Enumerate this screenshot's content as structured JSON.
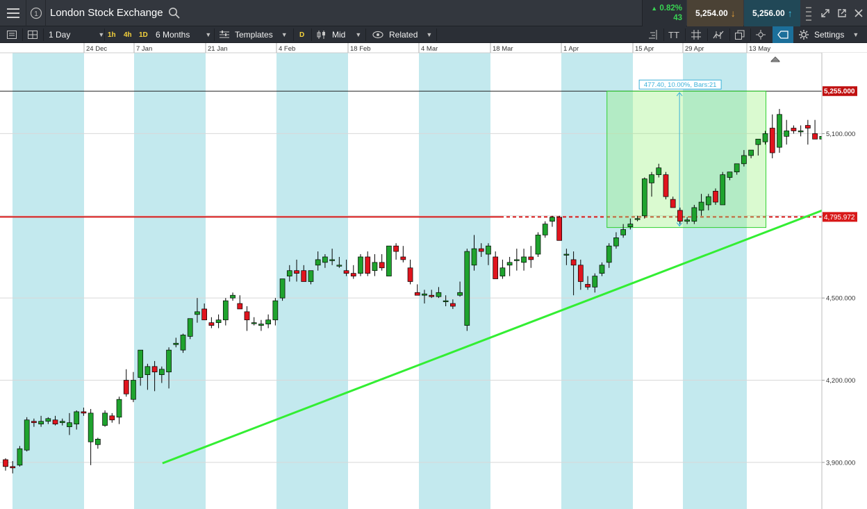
{
  "header": {
    "title": "London Stock Exchange",
    "change_pct": "0.82%",
    "change_pts": "43",
    "sell_price": "5,254.00",
    "buy_price": "5,256.00",
    "info_label": "1"
  },
  "toolbar": {
    "interval": "1 Day",
    "tf_1h": "1h",
    "tf_4h": "4h",
    "tf_1d": "1D",
    "period": "6 Months",
    "templates": "Templates",
    "d_badge": "D",
    "price_type": "Mid",
    "related": "Related",
    "font_label": "TT",
    "settings": "Settings"
  },
  "colors": {
    "up": "#1fa32e",
    "down": "#e0141e",
    "shade": "#c3e9ee",
    "trendline": "#33ee33",
    "hline": "#d81818",
    "measure": "#3ab0d8"
  },
  "chart_data": {
    "type": "candlestick",
    "x_tick_labels": [
      "24 Dec",
      "7 Jan",
      "21 Jan",
      "4 Feb",
      "18 Feb",
      "4 Mar",
      "18 Mar",
      "1 Apr",
      "15 Apr",
      "29 Apr",
      "13 May"
    ],
    "y_tick_labels": [
      "5,100.000",
      "4,800.000",
      "4,500.000",
      "4,200.000",
      "3,900.000"
    ],
    "y_ticks": [
      5100,
      4800,
      4500,
      4200,
      3900
    ],
    "ylim": [
      3730,
      5395
    ],
    "last_price_label": "5,255.000",
    "last_price": 5255,
    "hline_label": "4,795.972",
    "hline_price": 4795.972,
    "measure_label": "477.40, 10.00%, Bars:21",
    "measure_from_price": 4777.6,
    "measure_to_price": 5255,
    "trendline": {
      "from": {
        "bar": 22,
        "price": 3897
      },
      "to_price_right_edge": 4819
    },
    "candles": [
      [
        3910,
        3915,
        3870,
        3885
      ],
      [
        3885,
        3905,
        3860,
        3880
      ],
      [
        3890,
        3960,
        3885,
        3950
      ],
      [
        3945,
        4065,
        3940,
        4055
      ],
      [
        4050,
        4060,
        4030,
        4045
      ],
      [
        4040,
        4070,
        4030,
        4050
      ],
      [
        4050,
        4065,
        4040,
        4060
      ],
      [
        4055,
        4070,
        4035,
        4040
      ],
      [
        4045,
        4060,
        4035,
        4050
      ],
      [
        4030,
        4080,
        4000,
        4045
      ],
      [
        4040,
        4090,
        4020,
        4085
      ],
      [
        4085,
        4100,
        4070,
        4080
      ],
      [
        3975,
        4095,
        3890,
        4080
      ],
      [
        3965,
        3990,
        3950,
        3985
      ],
      [
        4035,
        4090,
        4030,
        4080
      ],
      [
        4070,
        4080,
        4045,
        4055
      ],
      [
        4065,
        4140,
        4040,
        4130
      ],
      [
        4200,
        4240,
        4140,
        4150
      ],
      [
        4130,
        4230,
        4120,
        4200
      ],
      [
        4210,
        4270,
        4180,
        4310
      ],
      [
        4220,
        4260,
        4165,
        4250
      ],
      [
        4250,
        4270,
        4160,
        4230
      ],
      [
        4220,
        4250,
        4190,
        4240
      ],
      [
        4230,
        4320,
        4170,
        4310
      ],
      [
        4330,
        4355,
        4320,
        4335
      ],
      [
        4310,
        4370,
        4300,
        4365
      ],
      [
        4360,
        4420,
        4350,
        4425
      ],
      [
        4440,
        4500,
        4410,
        4450
      ],
      [
        4460,
        4480,
        4425,
        4420
      ],
      [
        4410,
        4430,
        4390,
        4400
      ],
      [
        4410,
        4440,
        4390,
        4420
      ],
      [
        4420,
        4500,
        4400,
        4490
      ],
      [
        4500,
        4520,
        4490,
        4510
      ],
      [
        4480,
        4510,
        4460,
        4460
      ],
      [
        4450,
        4470,
        4380,
        4420
      ],
      [
        4410,
        4430,
        4400,
        4410
      ],
      [
        4400,
        4420,
        4380,
        4405
      ],
      [
        4405,
        4440,
        4390,
        4420
      ],
      [
        4420,
        4500,
        4400,
        4490
      ],
      [
        4500,
        4540,
        4490,
        4570
      ],
      [
        4580,
        4620,
        4560,
        4600
      ],
      [
        4600,
        4640,
        4560,
        4590
      ],
      [
        4600,
        4620,
        4560,
        4560
      ],
      [
        4560,
        4600,
        4550,
        4600
      ],
      [
        4620,
        4670,
        4600,
        4640
      ],
      [
        4630,
        4660,
        4610,
        4650
      ],
      [
        4640,
        4680,
        4620,
        4640
      ],
      [
        4620,
        4650,
        4610,
        4620
      ],
      [
        4600,
        4640,
        4580,
        4590
      ],
      [
        4590,
        4620,
        4570,
        4580
      ],
      [
        4590,
        4660,
        4580,
        4650
      ],
      [
        4650,
        4670,
        4580,
        4590
      ],
      [
        4600,
        4660,
        4580,
        4630
      ],
      [
        4630,
        4660,
        4600,
        4610
      ],
      [
        4580,
        4650,
        4600,
        4690
      ],
      [
        4690,
        4700,
        4640,
        4670
      ],
      [
        4650,
        4690,
        4630,
        4640
      ],
      [
        4610,
        4640,
        4550,
        4560
      ],
      [
        4520,
        4550,
        4510,
        4510
      ],
      [
        4510,
        4530,
        4480,
        4515
      ],
      [
        4510,
        4530,
        4500,
        4505
      ],
      [
        4505,
        4540,
        4500,
        4520
      ],
      [
        4490,
        4510,
        4470,
        4490
      ],
      [
        4480,
        4495,
        4460,
        4470
      ],
      [
        4510,
        4560,
        4505,
        4520
      ],
      [
        4400,
        4680,
        4380,
        4670
      ],
      [
        4620,
        4730,
        4600,
        4680
      ],
      [
        4680,
        4700,
        4650,
        4670
      ],
      [
        4660,
        4700,
        4620,
        4690
      ],
      [
        4650,
        4670,
        4580,
        4570
      ],
      [
        4580,
        4640,
        4570,
        4610
      ],
      [
        4620,
        4650,
        4580,
        4630
      ],
      [
        4640,
        4680,
        4600,
        4640
      ],
      [
        4630,
        4680,
        4600,
        4650
      ],
      [
        4650,
        4690,
        4610,
        4640
      ],
      [
        4660,
        4740,
        4650,
        4730
      ],
      [
        4730,
        4780,
        4720,
        4770
      ],
      [
        4780,
        4800,
        4760,
        4795
      ],
      [
        4795,
        4800,
        4720,
        4710
      ],
      [
        4660,
        4680,
        4620,
        4660
      ],
      [
        4640,
        4670,
        4510,
        4620
      ],
      [
        4620,
        4640,
        4530,
        4560
      ],
      [
        4550,
        4580,
        4530,
        4540
      ],
      [
        4540,
        4590,
        4520,
        4580
      ],
      [
        4590,
        4630,
        4580,
        4620
      ],
      [
        4630,
        4700,
        4610,
        4690
      ],
      [
        4690,
        4740,
        4680,
        4720
      ],
      [
        4730,
        4770,
        4720,
        4750
      ],
      [
        4760,
        4790,
        4750,
        4770
      ],
      [
        4790,
        4800,
        4780,
        4790
      ],
      [
        4800,
        4940,
        4790,
        4935
      ],
      [
        4920,
        4960,
        4870,
        4950
      ],
      [
        4950,
        4990,
        4940,
        4975
      ],
      [
        4950,
        4960,
        4860,
        4870
      ],
      [
        4860,
        4870,
        4830,
        4830
      ],
      [
        4820,
        4830,
        4770,
        4780
      ],
      [
        4780,
        4795,
        4770,
        4785
      ],
      [
        4780,
        4840,
        4770,
        4830
      ],
      [
        4820,
        4880,
        4800,
        4850
      ],
      [
        4840,
        4880,
        4820,
        4870
      ],
      [
        4890,
        4900,
        4840,
        4850
      ],
      [
        4840,
        4960,
        4840,
        4950
      ],
      [
        4940,
        4960,
        4930,
        4960
      ],
      [
        4960,
        4990,
        4950,
        4990
      ],
      [
        4990,
        5040,
        4980,
        5020
      ],
      [
        5020,
        5030,
        5010,
        5040
      ],
      [
        5060,
        5080,
        5020,
        5080
      ],
      [
        5070,
        5110,
        5060,
        5100
      ],
      [
        5120,
        5170,
        5010,
        5030
      ],
      [
        5050,
        5190,
        5030,
        5170
      ],
      [
        5090,
        5150,
        5060,
        5110
      ],
      [
        5120,
        5130,
        5100,
        5110
      ],
      [
        5110,
        5130,
        5090,
        5110
      ],
      [
        5130,
        5150,
        5060,
        5120
      ],
      [
        5100,
        5150,
        5080,
        5080
      ],
      [
        5080,
        5150,
        5060,
        5090
      ],
      [
        5110,
        5140,
        5040,
        5060
      ],
      [
        5050,
        5090,
        5030,
        5080
      ],
      [
        5090,
        5150,
        5080,
        5140
      ],
      [
        5140,
        5210,
        5130,
        5200
      ],
      [
        5210,
        5255,
        5190,
        5255
      ]
    ]
  }
}
